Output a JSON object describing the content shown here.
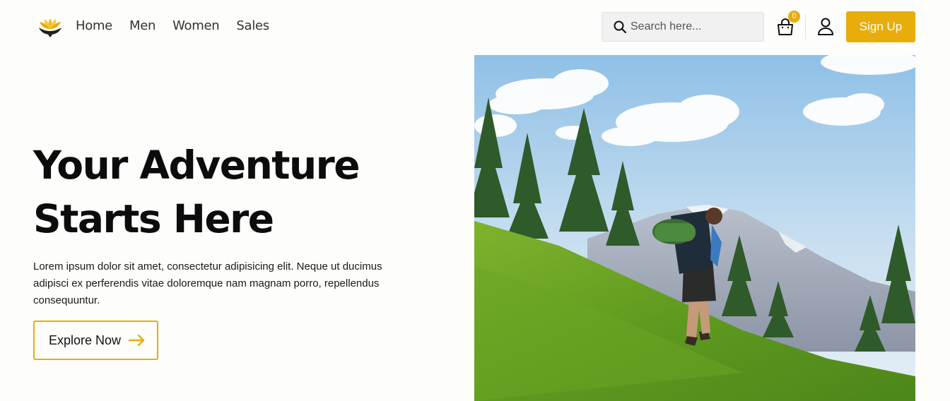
{
  "header": {
    "nav": [
      "Home",
      "Men",
      "Women",
      "Sales"
    ],
    "search_placeholder": "Search here...",
    "cart_count": "0",
    "signup_label": "Sign Up"
  },
  "hero": {
    "title_line1": "Your Adventure",
    "title_line2": "Starts Here",
    "text": "Lorem ipsum dolor sit amet, consectetur adipisicing elit. Neque ut ducimus adipisci ex perferendis vitae doloremque nam magnam porro, repellendus consequuntur.",
    "cta_label": "Explore Now"
  },
  "icons": {
    "logo": "lotus-logo",
    "search": "search-icon",
    "cart": "shopping-bag-icon",
    "user": "user-icon",
    "cta": "arrow-right-icon"
  },
  "colors": {
    "accent": "#e8ad0a",
    "background": "#fdfdfb",
    "text": "#111111"
  }
}
